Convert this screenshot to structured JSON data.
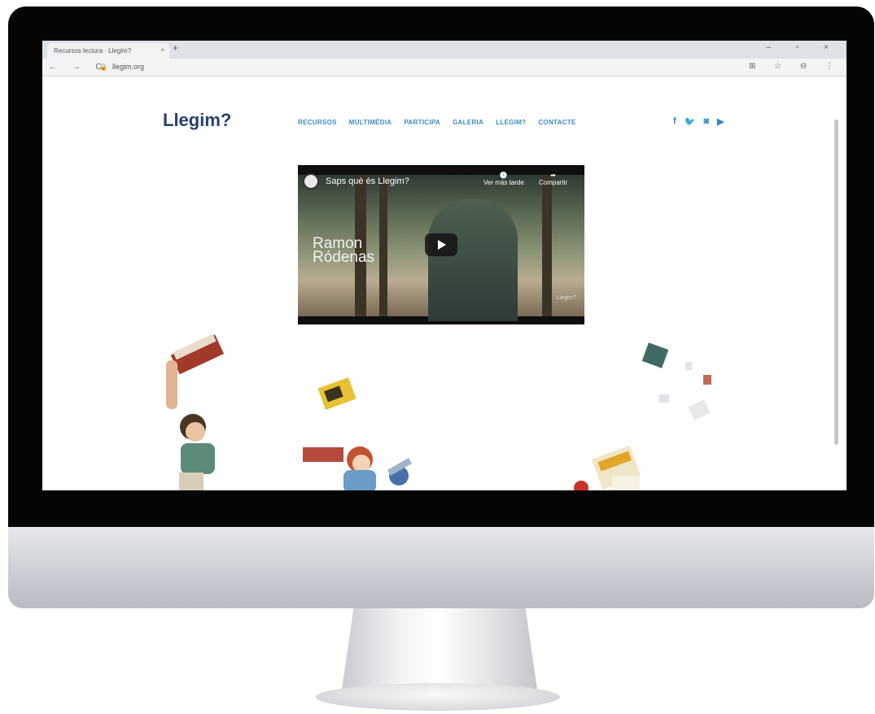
{
  "browser": {
    "tab_title": "Recursos lectura · Llegim?",
    "tab_close": "×",
    "new_tab": "+",
    "window_controls": "– ▫ ×",
    "nav_icons": "← → C",
    "url": "llegim.org",
    "right_icons": "⊞ ☆ ⊖ ⋮"
  },
  "site": {
    "logo": "Llegim?",
    "menu": [
      "RECURSOS",
      "MULTIMÈDIA",
      "PARTICIPA",
      "GALERIA",
      "LLEGIM?",
      "CONTACTE"
    ],
    "social_icons": [
      "f",
      "t",
      "ig",
      "yt"
    ]
  },
  "video": {
    "title": "Saps què és Llegim?",
    "watch_later": "Ver más tarde",
    "share": "Compartir",
    "name_line1": "Ramon",
    "name_line2": "Ródenas",
    "watermark": "Llegim?"
  },
  "colors": {
    "logo": "#27406e",
    "menu": "#3a8dc6",
    "social": "#2f86c6"
  }
}
